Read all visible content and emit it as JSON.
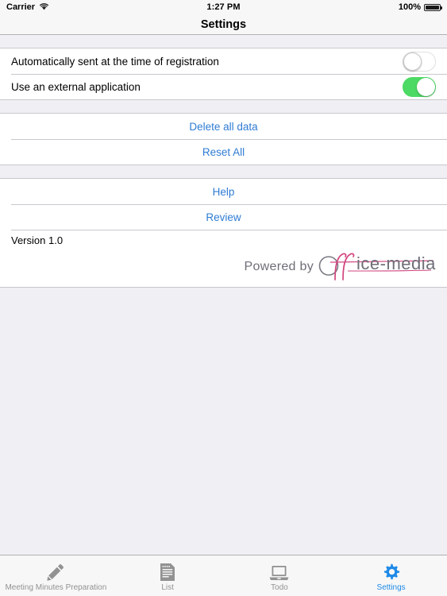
{
  "status_bar": {
    "carrier": "Carrier",
    "wifi_icon": "wifi-icon",
    "time": "1:27 PM",
    "battery_percent": "100%",
    "battery_icon": "battery-full-icon"
  },
  "nav_bar": {
    "title": "Settings"
  },
  "sections": {
    "toggles": [
      {
        "label": "Automatically sent at the time of registration",
        "state": "off"
      },
      {
        "label": "Use an external application",
        "state": "on"
      }
    ],
    "data_actions": [
      {
        "label": "Delete all data"
      },
      {
        "label": "Reset All"
      }
    ],
    "support_actions": [
      {
        "label": "Help"
      },
      {
        "label": "Review"
      }
    ],
    "version": {
      "label": "Version 1.0"
    },
    "branding": {
      "powered_by": "Powered by",
      "logo_text": "Office-media",
      "logo_suffix": "ice-media"
    }
  },
  "tab_bar": [
    {
      "label": "Meeting Minutes Preparation",
      "icon": "pencil-icon",
      "active": false
    },
    {
      "label": "List",
      "icon": "document-lines-icon",
      "active": false
    },
    {
      "label": "Todo",
      "icon": "laptop-icon",
      "active": false
    },
    {
      "label": "Settings",
      "icon": "gear-icon",
      "active": true
    }
  ],
  "colors": {
    "accent_blue": "#2F7CD4",
    "tab_active_blue": "#1E8AE8",
    "toggle_on_green": "#4CD964",
    "logo_pink": "#D2467F",
    "group_background": "#EFEFF4"
  }
}
